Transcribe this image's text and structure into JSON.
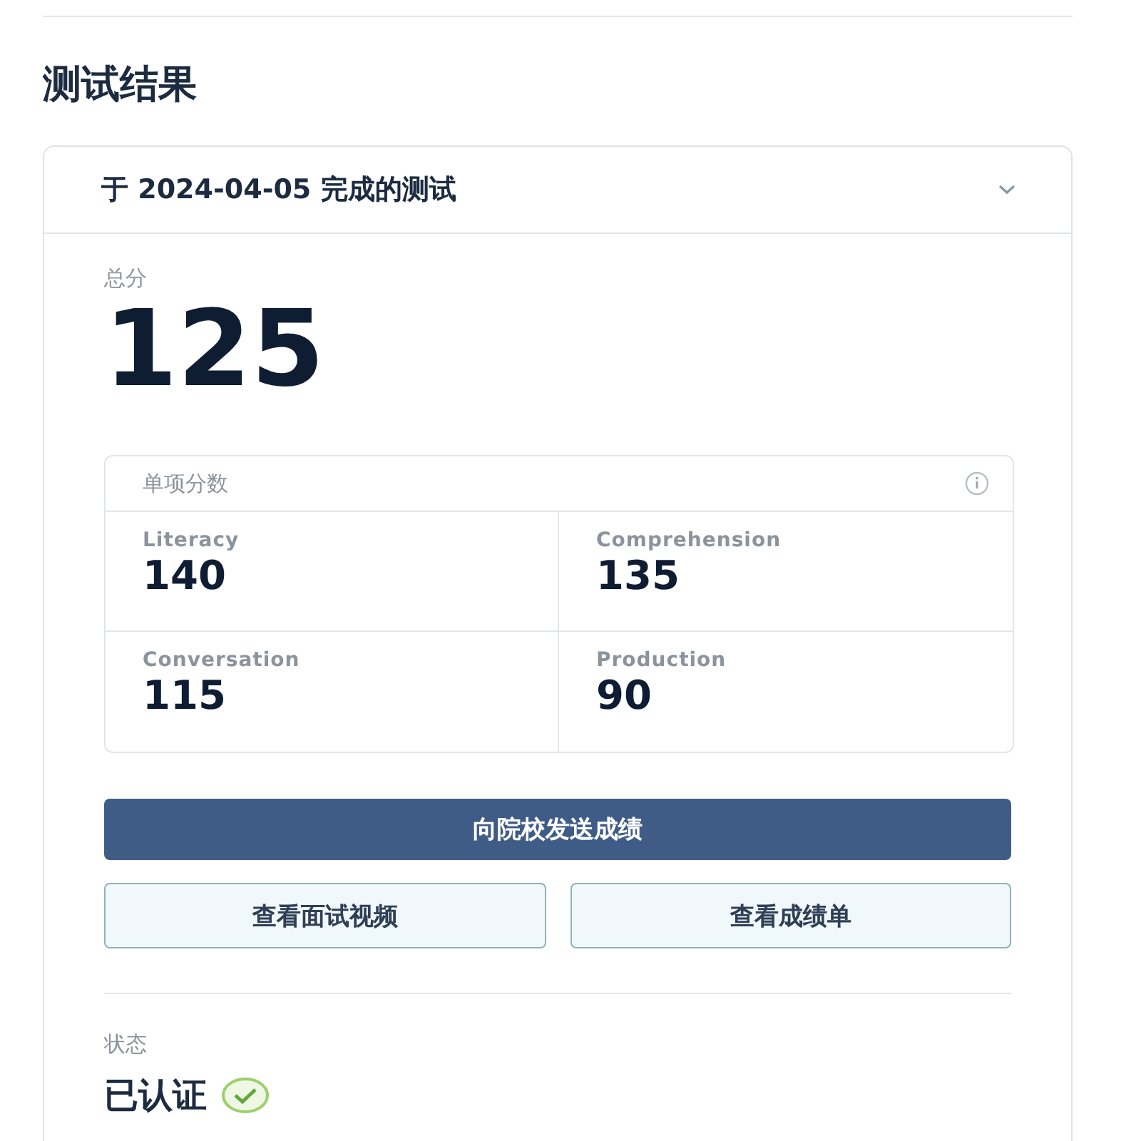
{
  "title": "测试结果",
  "test": {
    "header": "于 2024-04-05 完成的测试",
    "total_label": "总分",
    "total": "125",
    "subscores": {
      "title": "单项分数",
      "items": [
        {
          "label": "Literacy",
          "value": "140"
        },
        {
          "label": "Comprehension",
          "value": "135"
        },
        {
          "label": "Conversation",
          "value": "115"
        },
        {
          "label": "Production",
          "value": "90"
        }
      ]
    },
    "primary_button": "向院校发送成绩",
    "buttons": [
      "查看面试视频",
      "查看成绩单"
    ],
    "status_label": "状态",
    "status": "已认证",
    "verified": true
  }
}
